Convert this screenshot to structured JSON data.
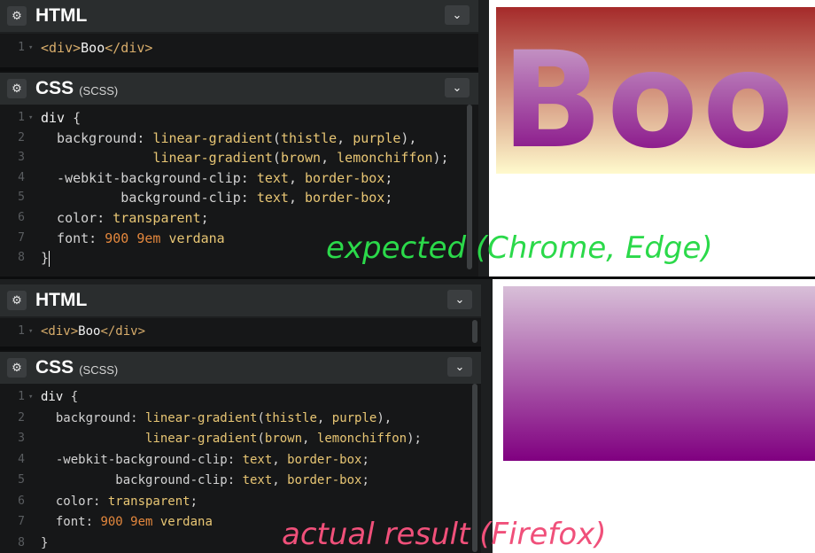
{
  "top": {
    "html_pane": {
      "title": "HTML",
      "collapse_icon": "chevron-down-icon",
      "gear_icon": "gear-icon",
      "lines": [
        {
          "n": "1",
          "tokens": [
            {
              "c": "tag",
              "t": "<div>"
            },
            {
              "c": "plain",
              "t": "Boo"
            },
            {
              "c": "tag",
              "t": "</div>"
            }
          ]
        }
      ]
    },
    "css_pane": {
      "title": "CSS",
      "subtitle": "(SCSS)",
      "lines": [
        {
          "n": "1",
          "tokens": [
            {
              "c": "sel",
              "t": "div "
            },
            {
              "c": "pun",
              "t": "{"
            }
          ]
        },
        {
          "n": "2",
          "tokens": [
            {
              "c": "prop",
              "t": "  background: "
            },
            {
              "c": "val",
              "t": "linear-gradient"
            },
            {
              "c": "pun",
              "t": "("
            },
            {
              "c": "val",
              "t": "thistle"
            },
            {
              "c": "pun",
              "t": ", "
            },
            {
              "c": "val",
              "t": "purple"
            },
            {
              "c": "pun",
              "t": "),"
            }
          ]
        },
        {
          "n": "3",
          "tokens": [
            {
              "c": "prop",
              "t": "              "
            },
            {
              "c": "val",
              "t": "linear-gradient"
            },
            {
              "c": "pun",
              "t": "("
            },
            {
              "c": "val",
              "t": "brown"
            },
            {
              "c": "pun",
              "t": ", "
            },
            {
              "c": "val",
              "t": "lemonchiffon"
            },
            {
              "c": "pun",
              "t": ");"
            }
          ]
        },
        {
          "n": "4",
          "tokens": [
            {
              "c": "prop",
              "t": "  -webkit-background-clip: "
            },
            {
              "c": "val",
              "t": "text"
            },
            {
              "c": "pun",
              "t": ", "
            },
            {
              "c": "val",
              "t": "border-box"
            },
            {
              "c": "pun",
              "t": ";"
            }
          ]
        },
        {
          "n": "5",
          "tokens": [
            {
              "c": "prop",
              "t": "          background-clip: "
            },
            {
              "c": "val",
              "t": "text"
            },
            {
              "c": "pun",
              "t": ", "
            },
            {
              "c": "val",
              "t": "border-box"
            },
            {
              "c": "pun",
              "t": ";"
            }
          ]
        },
        {
          "n": "6",
          "tokens": [
            {
              "c": "prop",
              "t": "  color: "
            },
            {
              "c": "val",
              "t": "transparent"
            },
            {
              "c": "pun",
              "t": ";"
            }
          ]
        },
        {
          "n": "7",
          "tokens": [
            {
              "c": "prop",
              "t": "  font: "
            },
            {
              "c": "num",
              "t": "900 9em"
            },
            {
              "c": "val",
              "t": " verdana"
            }
          ]
        },
        {
          "n": "8",
          "tokens": [
            {
              "c": "pun",
              "t": "}"
            }
          ]
        }
      ]
    },
    "preview_text": "Boo",
    "annotation": "expected (Chrome, Edge)",
    "annotation_color": "#2bd94a"
  },
  "bottom": {
    "html_pane": {
      "title": "HTML"
    },
    "css_pane": {
      "title": "CSS",
      "subtitle": "(SCSS)"
    },
    "annotation": "actual result (Firefox)",
    "annotation_color": "#f0507a"
  },
  "colors": {
    "thistle": "#d8bfd8",
    "purple": "#800080",
    "brown": "#a52a2a",
    "lemonchiffon": "#fffacd"
  }
}
